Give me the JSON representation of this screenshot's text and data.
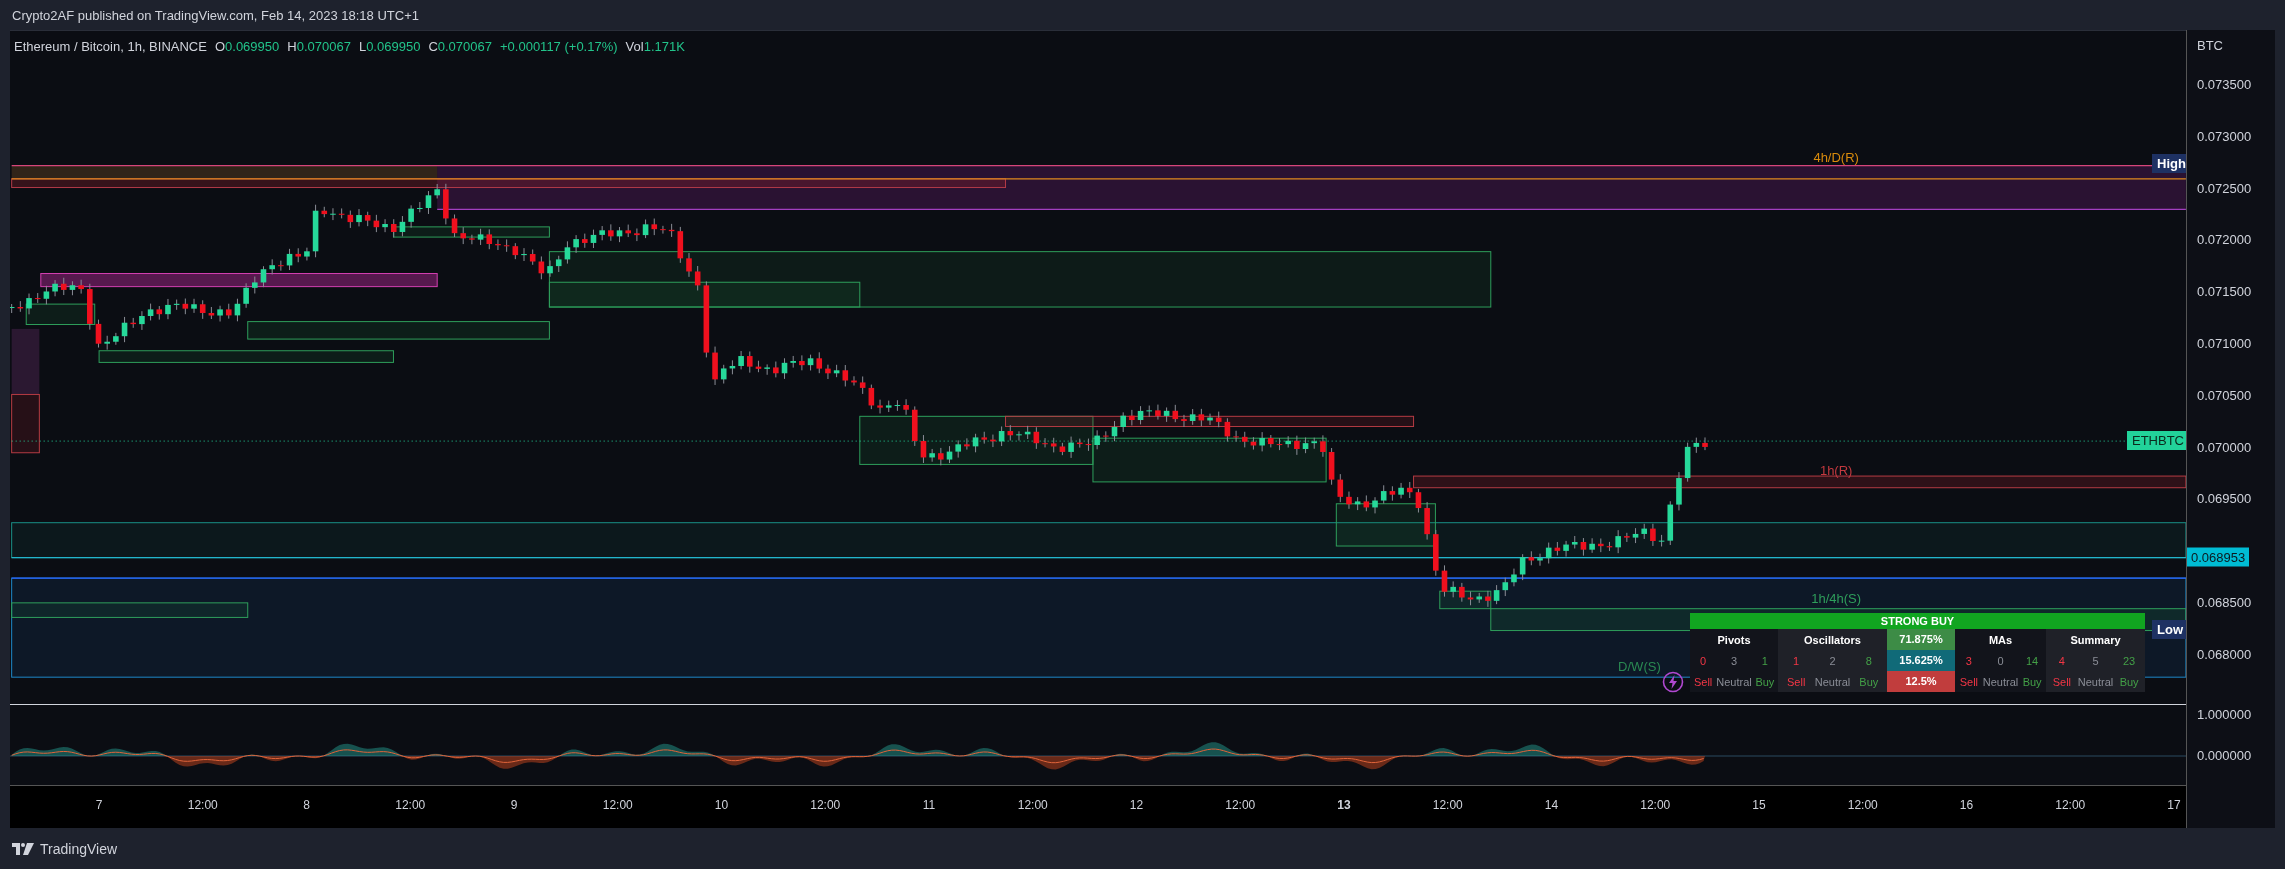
{
  "header": {
    "publisher_line": "Crypto2AF published on TradingView.com, Feb 14, 2023 18:18 UTC+1"
  },
  "legend": {
    "symbol": "Ethereum / Bitcoin, 1h, BINANCE",
    "fields": [
      {
        "label": "O",
        "value": "0.069950"
      },
      {
        "label": "H",
        "value": "0.070067"
      },
      {
        "label": "L",
        "value": "0.069950"
      },
      {
        "label": "C",
        "value": "0.070067"
      }
    ],
    "change": "+0.000117 (+0.17%)",
    "volume": {
      "label": "Vol",
      "value": "1.171K"
    }
  },
  "zone_labels": [
    {
      "text": "4h/D(R)",
      "color": "#d98b0c"
    },
    {
      "text": "1h(R)",
      "color": "#c4393f"
    },
    {
      "text": "1h/4h(S)",
      "color": "#2e9e5b"
    },
    {
      "text": "D/W(S)",
      "color": "#2a8a52"
    }
  ],
  "range_tags": {
    "high": "High",
    "low": "Low"
  },
  "symbol_tag": "ETHBTC",
  "price_axis": {
    "unit": "BTC",
    "labels": [
      "0.073500",
      "0.073000",
      "0.072500",
      "0.072000",
      "0.071500",
      "0.071000",
      "0.070500",
      "0.070000",
      "0.069500",
      "0.068500",
      "0.068000"
    ],
    "current_price": "0.068953"
  },
  "oscillator_axis": {
    "labels": [
      "1.000000",
      "0.000000"
    ]
  },
  "rating_table": {
    "title": "STRONG BUY",
    "groups": [
      {
        "name": "Pivots",
        "counts": [
          "0",
          "3",
          "1"
        ],
        "labels": [
          "Sell",
          "Neutral",
          "Buy"
        ]
      },
      {
        "name": "Oscillators",
        "counts": [
          "1",
          "2",
          "8"
        ],
        "labels": [
          "Sell",
          "Neutral",
          "Buy"
        ]
      },
      {
        "name": "MAs",
        "counts": [
          "3",
          "0",
          "14"
        ],
        "labels": [
          "Sell",
          "Neutral",
          "Buy"
        ]
      },
      {
        "name": "Summary",
        "counts": [
          "4",
          "5",
          "23"
        ],
        "labels": [
          "Sell",
          "Neutral",
          "Buy"
        ]
      }
    ],
    "percentages": [
      {
        "kind": "buy",
        "text": "71.875%"
      },
      {
        "kind": "neutral",
        "text": "15.625%"
      },
      {
        "kind": "sell",
        "text": "12.5%"
      }
    ]
  },
  "time_axis": {
    "ticks": [
      {
        "label": "7",
        "bold": false
      },
      {
        "label": "12:00",
        "bold": false
      },
      {
        "label": "8",
        "bold": false
      },
      {
        "label": "12:00",
        "bold": false
      },
      {
        "label": "9",
        "bold": false
      },
      {
        "label": "12:00",
        "bold": false
      },
      {
        "label": "10",
        "bold": false
      },
      {
        "label": "12:00",
        "bold": false
      },
      {
        "label": "11",
        "bold": false
      },
      {
        "label": "12:00",
        "bold": false
      },
      {
        "label": "12",
        "bold": false
      },
      {
        "label": "12:00",
        "bold": false
      },
      {
        "label": "13",
        "bold": true
      },
      {
        "label": "12:00",
        "bold": false
      },
      {
        "label": "14",
        "bold": false
      },
      {
        "label": "12:00",
        "bold": false
      },
      {
        "label": "15",
        "bold": false
      },
      {
        "label": "12:00",
        "bold": false
      },
      {
        "label": "16",
        "bold": false
      },
      {
        "label": "12:00",
        "bold": false
      },
      {
        "label": "17",
        "bold": false
      }
    ]
  },
  "footer": {
    "brand": "TradingView"
  }
}
